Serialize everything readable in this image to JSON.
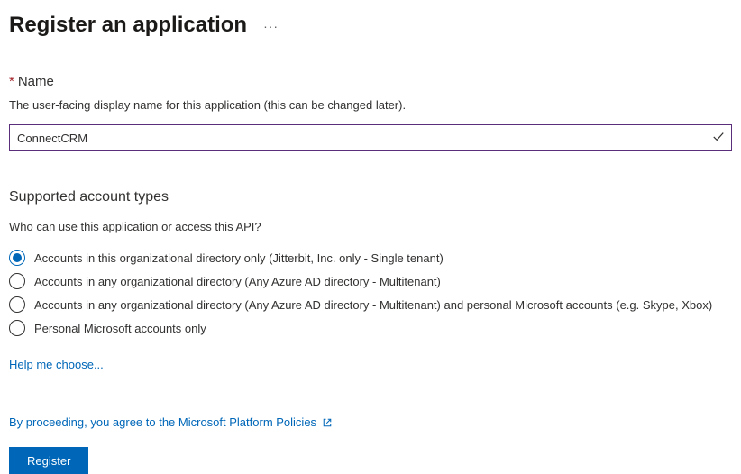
{
  "header": {
    "title": "Register an application"
  },
  "name_field": {
    "label": "Name",
    "description": "The user-facing display name for this application (this can be changed later).",
    "value": "ConnectCRM"
  },
  "account_types": {
    "title": "Supported account types",
    "description": "Who can use this application or access this API?",
    "options": [
      {
        "label": "Accounts in this organizational directory only (Jitterbit, Inc. only - Single tenant)",
        "selected": true
      },
      {
        "label": "Accounts in any organizational directory (Any Azure AD directory - Multitenant)",
        "selected": false
      },
      {
        "label": "Accounts in any organizational directory (Any Azure AD directory - Multitenant) and personal Microsoft accounts (e.g. Skype, Xbox)",
        "selected": false
      },
      {
        "label": "Personal Microsoft accounts only",
        "selected": false
      }
    ],
    "help_link": "Help me choose..."
  },
  "footer": {
    "agree_text": "By proceeding, you agree to the Microsoft Platform Policies",
    "register_label": "Register"
  }
}
